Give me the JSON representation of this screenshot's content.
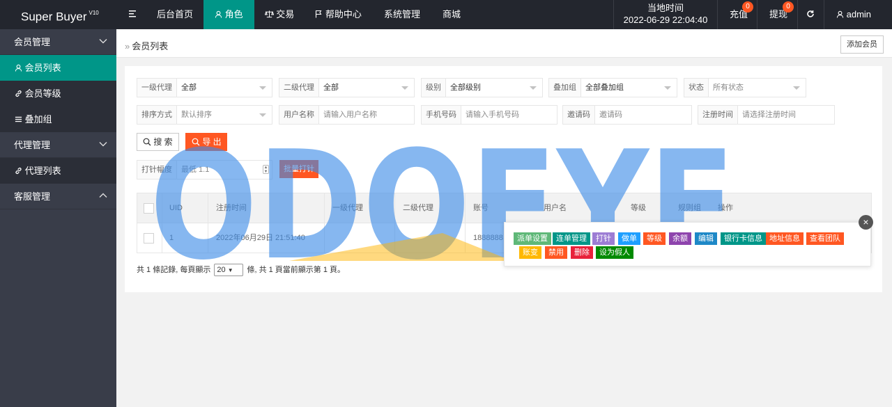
{
  "app": {
    "title": "Super Buyer",
    "version": "V10"
  },
  "topnav": {
    "menu_icon": "menu-icon",
    "items": [
      {
        "label": "后台首页",
        "icon": ""
      },
      {
        "label": "角色",
        "icon": "user-icon"
      },
      {
        "label": "交易",
        "icon": "scale-icon"
      },
      {
        "label": "帮助中心",
        "icon": "flag-icon"
      },
      {
        "label": "系统管理",
        "icon": ""
      },
      {
        "label": "商城",
        "icon": ""
      }
    ],
    "time_label": "当地时间",
    "time_value": "2022-06-29 22:04:40",
    "recharge": "充值",
    "recharge_badge": "0",
    "withdraw": "提现",
    "withdraw_badge": "0",
    "user": "admin"
  },
  "sidebar": {
    "groups": [
      {
        "label": "会员管理",
        "items": [
          {
            "label": "会员列表",
            "icon": "user-icon"
          },
          {
            "label": "会员等级",
            "icon": "link-icon"
          },
          {
            "label": "叠加组",
            "icon": "list-icon"
          }
        ]
      },
      {
        "label": "代理管理",
        "items": [
          {
            "label": "代理列表",
            "icon": "link-icon"
          }
        ]
      },
      {
        "label": "客服管理",
        "items": []
      }
    ]
  },
  "breadcrumb": {
    "current": "会员列表"
  },
  "add_button": "添加会员",
  "filters": {
    "agent1": {
      "label": "一级代理",
      "value": "全部"
    },
    "agent2": {
      "label": "二级代理",
      "value": "全部"
    },
    "level": {
      "label": "级别",
      "value": "全部级别"
    },
    "stack": {
      "label": "叠加组",
      "value": "全部叠加组"
    },
    "status": {
      "label": "状态",
      "placeholder": "所有状态"
    },
    "sort": {
      "label": "排序方式",
      "placeholder": "默认排序"
    },
    "username": {
      "label": "用户名称",
      "placeholder": "请输入用户名称"
    },
    "phone": {
      "label": "手机号码",
      "placeholder": "请输入手机号码"
    },
    "invite": {
      "label": "邀请码",
      "placeholder": "邀请码"
    },
    "regtime": {
      "label": "注册时间",
      "placeholder": "请选择注册时间"
    },
    "search_btn": "搜 索",
    "export_btn": "导 出",
    "punch": {
      "label": "打针幅度",
      "placeholder": "最低 1.1"
    },
    "batch_btn": "批量打针"
  },
  "table": {
    "headers": [
      "UID",
      "注册时间",
      "一级代理",
      "二级代理",
      "账号",
      "用户名",
      "等级",
      "规则组",
      "操作"
    ],
    "rows": [
      {
        "uid": "1",
        "regtime": "2022年06月29日 21:51:40",
        "agent1": "",
        "agent2": "",
        "account": "1888888",
        "username": "",
        "level": "",
        "group": ""
      }
    ]
  },
  "actions": [
    {
      "label": "派单设置",
      "color": "#5fb878"
    },
    {
      "label": "连单管理",
      "color": "#009688"
    },
    {
      "label": "打针",
      "color": "#9c7dd4"
    },
    {
      "label": "做单",
      "color": "#1e9fff"
    },
    {
      "label": "等级",
      "color": "#ff5722"
    },
    {
      "label": "余额",
      "color": "#8e44ad"
    },
    {
      "label": "编辑",
      "color": "#1e88c7"
    },
    {
      "label": "银行卡信息",
      "color": "#009688"
    },
    {
      "label": "地址信息",
      "color": "#ff5722"
    },
    {
      "label": "查看团队",
      "color": "#ff5722"
    },
    {
      "label": "账变",
      "color": "#ffb800"
    },
    {
      "label": "禁用",
      "color": "#ff5722"
    },
    {
      "label": "删除",
      "color": "#e8213a"
    },
    {
      "label": "设为假人",
      "color": "#008a00"
    }
  ],
  "pager": {
    "prefix": "共 1 條記錄, 每頁顯示",
    "page_size": "20",
    "suffix": "條, 共 1 頁當前顯示第 1 頁。"
  },
  "watermark": {
    "text": "ODOEYE"
  }
}
